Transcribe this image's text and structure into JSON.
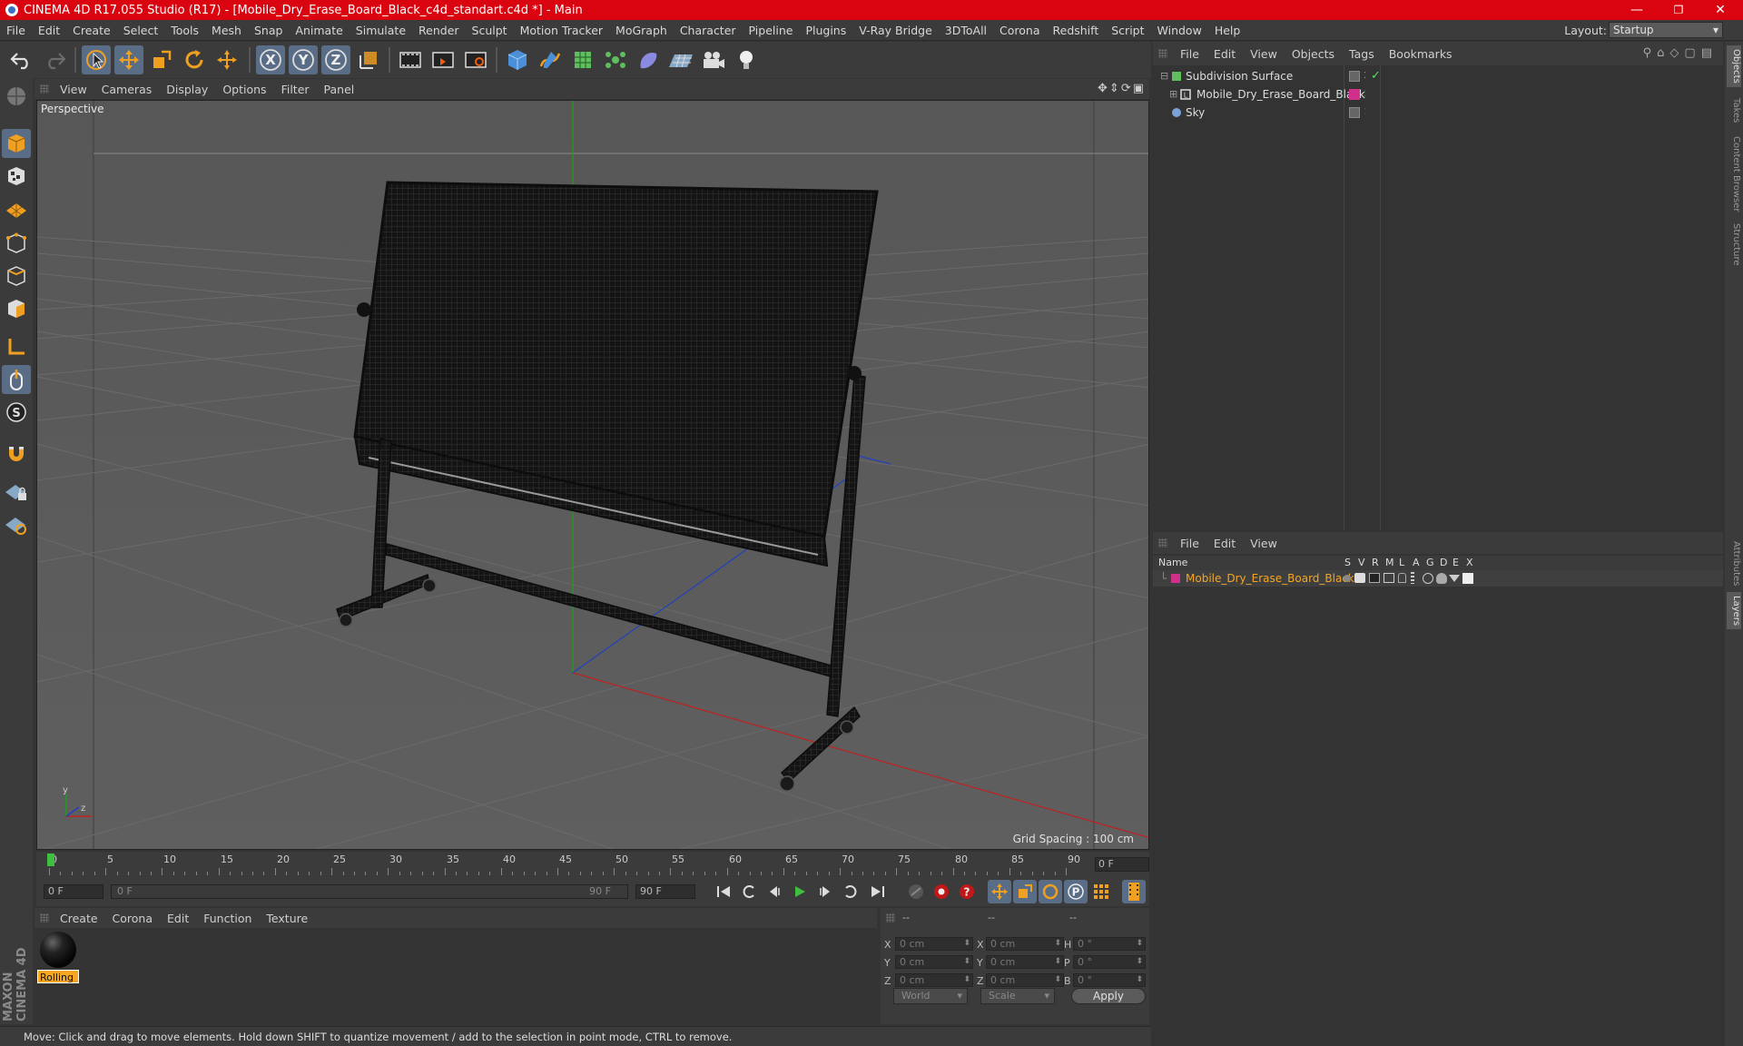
{
  "window": {
    "title": "CINEMA 4D R17.055 Studio (R17) - [Mobile_Dry_Erase_Board_Black_c4d_standart.c4d *] - Main",
    "minimize": "—",
    "restore": "❐",
    "close": "✕"
  },
  "menubar": {
    "items": [
      "File",
      "Edit",
      "Create",
      "Select",
      "Tools",
      "Mesh",
      "Snap",
      "Animate",
      "Simulate",
      "Render",
      "Sculpt",
      "Motion Tracker",
      "MoGraph",
      "Character",
      "Pipeline",
      "Plugins",
      "V-Ray Bridge",
      "3DToAll",
      "Corona",
      "Redshift",
      "Script",
      "Window",
      "Help"
    ],
    "layout_label": "Layout:",
    "layout_value": "Startup"
  },
  "toolbar": {
    "axis_x": "X",
    "axis_y": "Y",
    "axis_z": "Z"
  },
  "viewport": {
    "menu": [
      "View",
      "Cameras",
      "Display",
      "Options",
      "Filter",
      "Panel"
    ],
    "label": "Perspective",
    "grid_spacing": "Grid Spacing : 100 cm",
    "axis_y": "y",
    "axis_z": "z"
  },
  "timeline": {
    "ticks": [
      "0",
      "5",
      "10",
      "15",
      "20",
      "25",
      "30",
      "35",
      "40",
      "45",
      "50",
      "55",
      "60",
      "65",
      "70",
      "75",
      "80",
      "85",
      "90"
    ],
    "current_frame": "0 F"
  },
  "transport": {
    "start_frame": "0 F",
    "range_start": "0 F",
    "range_end": "90 F",
    "end_frame": "90 F"
  },
  "material_manager": {
    "menu": [
      "Create",
      "Corona",
      "Edit",
      "Function",
      "Texture"
    ],
    "material_name": "Rolling"
  },
  "coordinates": {
    "header": [
      "--",
      "--",
      "--"
    ],
    "rows": [
      {
        "a": "X",
        "av": "0 cm",
        "b": "X",
        "bv": "0 cm",
        "c": "H",
        "cv": "0 °"
      },
      {
        "a": "Y",
        "av": "0 cm",
        "b": "Y",
        "bv": "0 cm",
        "c": "P",
        "cv": "0 °"
      },
      {
        "a": "Z",
        "av": "0 cm",
        "b": "Z",
        "bv": "0 cm",
        "c": "B",
        "cv": "0 °"
      }
    ],
    "space": "World",
    "mode": "Scale",
    "apply": "Apply"
  },
  "status_text": "Move: Click and drag to move elements. Hold down SHIFT to quantize movement / add to the selection in point mode, CTRL to remove.",
  "object_manager": {
    "menu": [
      "File",
      "Edit",
      "View",
      "Objects",
      "Tags",
      "Bookmarks"
    ],
    "objects": [
      {
        "name": "Subdivision Surface",
        "color": "#5fbf5f"
      },
      {
        "name": "Mobile_Dry_Erase_Board_Black",
        "color": "#d0308a"
      },
      {
        "name": "Sky",
        "color": "#7aa2d8"
      }
    ]
  },
  "layer_manager": {
    "menu": [
      "File",
      "Edit",
      "View"
    ],
    "columns": [
      "Name",
      "S",
      "V",
      "R",
      "M",
      "L",
      "A",
      "G",
      "D",
      "E",
      "X"
    ],
    "layer_name": "Mobile_Dry_Erase_Board_Black",
    "layer_color": "#d0308a"
  },
  "right_tabs": [
    "Objects",
    "Takes",
    "Content Browser",
    "Structure",
    "Attributes",
    "Layers"
  ],
  "colors": {
    "accent_title": "#d9040f",
    "selected_tool": "#5a6d86",
    "highlight_text": "#f5a623"
  },
  "branding": "MAXON CINEMA 4D"
}
